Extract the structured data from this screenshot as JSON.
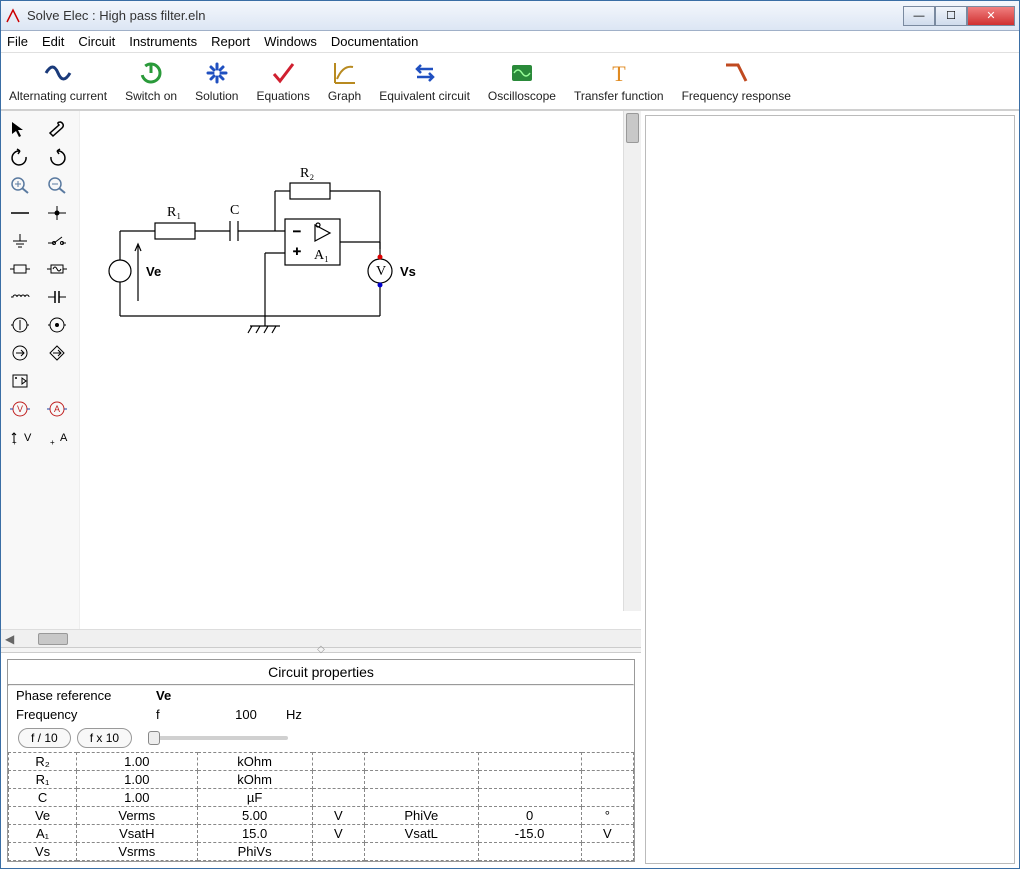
{
  "window": {
    "title": "Solve Elec : High pass filter.eln"
  },
  "menu": [
    "File",
    "Edit",
    "Circuit",
    "Instruments",
    "Report",
    "Windows",
    "Documentation"
  ],
  "toolbar": [
    {
      "icon": "alternating-current",
      "label": "Alternating current"
    },
    {
      "icon": "switch-on",
      "label": "Switch on"
    },
    {
      "icon": "solution",
      "label": "Solution"
    },
    {
      "icon": "equations",
      "label": "Equations"
    },
    {
      "icon": "graph",
      "label": "Graph"
    },
    {
      "icon": "equivalent",
      "label": "Equivalent circuit"
    },
    {
      "icon": "oscilloscope",
      "label": "Oscilloscope"
    },
    {
      "icon": "transfer",
      "label": "Transfer function"
    },
    {
      "icon": "frequency",
      "label": "Frequency response"
    }
  ],
  "palette": [
    "pointer",
    "wrench",
    "rotate-ccw",
    "rotate-cw",
    "zoom-in",
    "zoom-out",
    "wire",
    "node",
    "ground",
    "switch",
    "resistor",
    "source-ac",
    "inductor",
    "capacitor",
    "current-source",
    "voltage-source",
    "dep-csrc",
    "dep-vsrc",
    "opamp",
    "",
    "voltmeter",
    "ammeter",
    "probe-v",
    "probe-a"
  ],
  "circuit": {
    "R1": "R₁",
    "R2": "R₂",
    "C": "C",
    "A1": "A₁",
    "Ve": "Ve",
    "Vs": "Vs",
    "V": "V"
  },
  "props": {
    "title": "Circuit properties",
    "phase_ref_label": "Phase reference",
    "phase_ref": "Ve",
    "freq_label": "Frequency",
    "freq_sym": "f",
    "freq_val": "100",
    "freq_unit": "Hz",
    "btn_div": "f / 10",
    "btn_mul": "f x 10",
    "rows": [
      {
        "c": [
          "R₂",
          "1.00",
          "kOhm",
          "",
          "",
          "",
          ""
        ]
      },
      {
        "c": [
          "R₁",
          "1.00",
          "kOhm",
          "",
          "",
          "",
          ""
        ]
      },
      {
        "c": [
          "C",
          "1.00",
          "µF",
          "",
          "",
          "",
          ""
        ]
      },
      {
        "c": [
          "Ve",
          "Verms",
          "5.00",
          "V",
          "PhiVe",
          "0",
          "°"
        ],
        "bold": true
      },
      {
        "c": [
          "A₁",
          "VsatH",
          "15.0",
          "V",
          "VsatL",
          "-15.0",
          "V"
        ]
      },
      {
        "c": [
          "Vs",
          "Vsrms",
          "PhiVs",
          "",
          "",
          "",
          ""
        ],
        "bold": true
      }
    ]
  }
}
